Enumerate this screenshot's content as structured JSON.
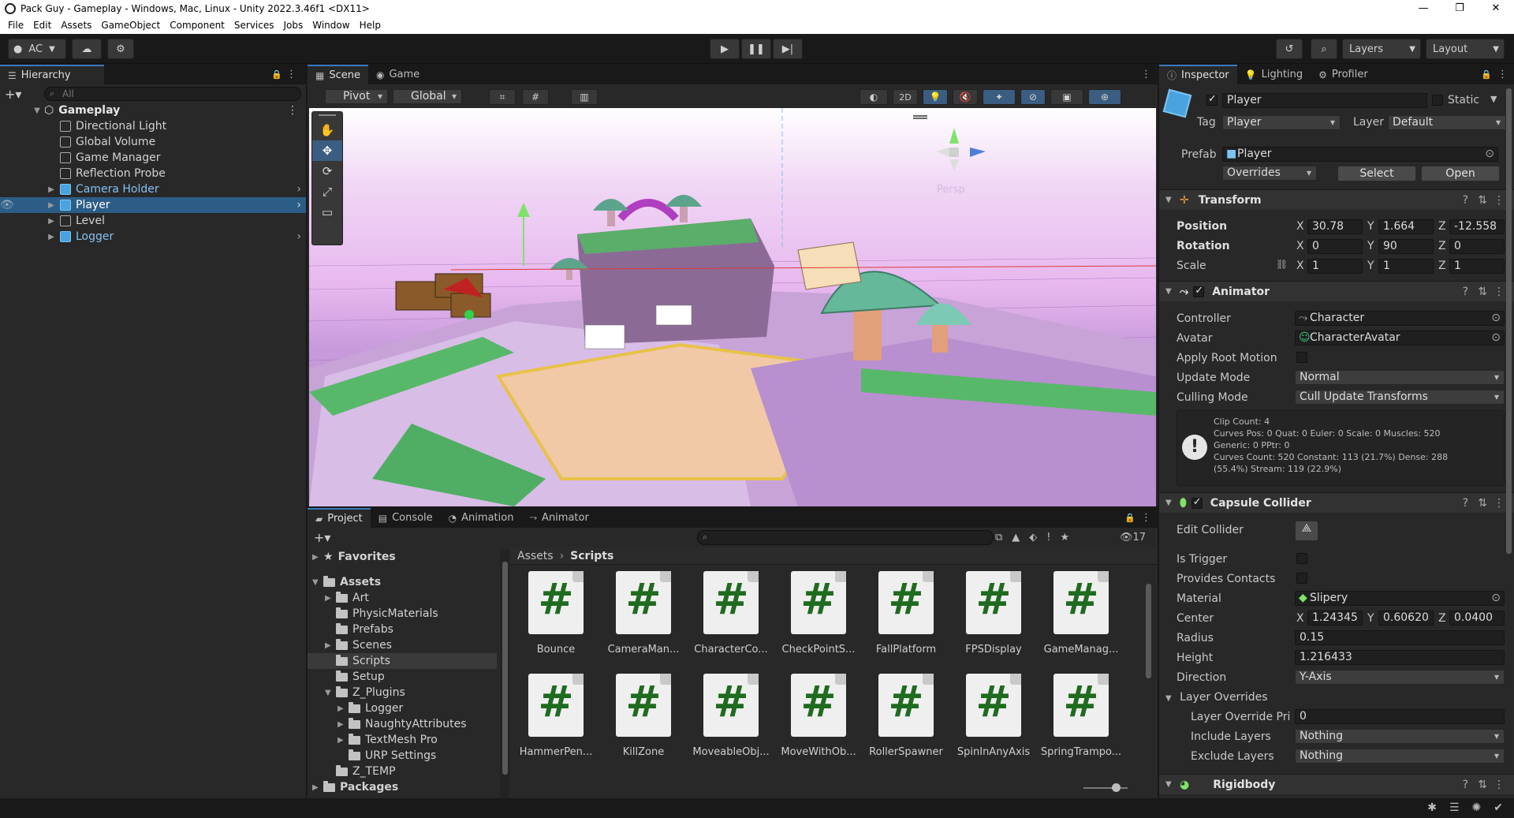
{
  "window": {
    "title": "Pack Guy - Gameplay - Windows, Mac, Linux - Unity 2022.3.46f1 <DX11>",
    "controls": [
      "—",
      "❐",
      "✕"
    ]
  },
  "menu": [
    "File",
    "Edit",
    "Assets",
    "GameObject",
    "Component",
    "Services",
    "Jobs",
    "Window",
    "Help"
  ],
  "toolbar": {
    "account": "AC",
    "layers": "Layers",
    "layout": "Layout"
  },
  "hierarchy": {
    "tab": "Hierarchy",
    "search_placeholder": "All",
    "scene": "Gameplay",
    "items": [
      {
        "label": "Directional Light",
        "prefab": false
      },
      {
        "label": "Global Volume",
        "prefab": false
      },
      {
        "label": "Game Manager",
        "prefab": false
      },
      {
        "label": "Reflection Probe",
        "prefab": false
      },
      {
        "label": "Camera Holder",
        "prefab": true
      },
      {
        "label": "Player",
        "prefab": true
      },
      {
        "label": "Level",
        "prefab": false
      },
      {
        "label": "Logger",
        "prefab": true
      }
    ]
  },
  "scene": {
    "tabs": [
      "Scene",
      "Game"
    ],
    "pivot": "Pivot",
    "global": "Global",
    "mode2d": "2D",
    "persp": "Persp"
  },
  "project": {
    "tabs": [
      "Project",
      "Console",
      "Animation",
      "Animator"
    ],
    "count": "17",
    "breadcrumb": [
      "Assets",
      "Scripts"
    ],
    "tree": [
      {
        "label": "Favorites",
        "depth": 0,
        "bold": true
      },
      {
        "label": "Assets",
        "depth": 0,
        "bold": true
      },
      {
        "label": "Art",
        "depth": 1
      },
      {
        "label": "PhysicMaterials",
        "depth": 1
      },
      {
        "label": "Prefabs",
        "depth": 1
      },
      {
        "label": "Scenes",
        "depth": 1
      },
      {
        "label": "Scripts",
        "depth": 1
      },
      {
        "label": "Setup",
        "depth": 1
      },
      {
        "label": "Z_Plugins",
        "depth": 1
      },
      {
        "label": "Logger",
        "depth": 2
      },
      {
        "label": "NaughtyAttributes",
        "depth": 2
      },
      {
        "label": "TextMesh Pro",
        "depth": 2
      },
      {
        "label": "URP Settings",
        "depth": 2
      },
      {
        "label": "Z_TEMP",
        "depth": 1
      },
      {
        "label": "Packages",
        "depth": 0,
        "bold": true
      }
    ],
    "assets": [
      "Bounce",
      "CameraMan...",
      "CharacterCo...",
      "CheckPointS...",
      "FallPlatform",
      "FPSDisplay",
      "GameManag...",
      "HammerPen...",
      "KillZone",
      "MoveableObj...",
      "MoveWithOb...",
      "RollerSpawner",
      "SpinInAnyAxis",
      "SpringTrampo..."
    ]
  },
  "inspector": {
    "tabs": [
      "Inspector",
      "Lighting",
      "Profiler"
    ],
    "name": "Player",
    "static": "Static",
    "tag_label": "Tag",
    "tag": "Player",
    "layer_label": "Layer",
    "layer": "Default",
    "prefab_label": "Prefab",
    "prefab": "Player",
    "overrides": "Overrides",
    "select": "Select",
    "open": "Open",
    "transform": {
      "title": "Transform",
      "position": {
        "label": "Position",
        "x": "30.78",
        "y": "1.664",
        "z": "-12.558"
      },
      "rotation": {
        "label": "Rotation",
        "x": "0",
        "y": "90",
        "z": "0"
      },
      "scale": {
        "label": "Scale",
        "x": "1",
        "y": "1",
        "z": "1"
      }
    },
    "animator": {
      "title": "Animator",
      "controller_label": "Controller",
      "controller": "Character",
      "avatar_label": "Avatar",
      "avatar": "CharacterAvatar",
      "root_motion_label": "Apply Root Motion",
      "update_mode_label": "Update Mode",
      "update_mode": "Normal",
      "culling_mode_label": "Culling Mode",
      "culling_mode": "Cull Update Transforms",
      "info": [
        "Clip Count: 4",
        "Curves Pos: 0 Quat: 0 Euler: 0 Scale: 0 Muscles: 520",
        "Generic: 0 PPtr: 0",
        "Curves Count: 520 Constant: 113 (21.7%) Dense: 288",
        "(55.4%) Stream: 119 (22.9%)"
      ]
    },
    "capsule": {
      "title": "Capsule Collider",
      "edit_label": "Edit Collider",
      "trigger_label": "Is Trigger",
      "contacts_label": "Provides Contacts",
      "material_label": "Material",
      "material": "Slipery",
      "center_label": "Center",
      "cx": "1.24345",
      "cy": "0.60620",
      "cz": "0.0400",
      "radius_label": "Radius",
      "radius": "0.15",
      "height_label": "Height",
      "height": "1.216433",
      "direction_label": "Direction",
      "direction": "Y-Axis",
      "layer_overrides": "Layer Overrides",
      "override_priority_label": "Layer Override Pri",
      "override_priority": "0",
      "include_label": "Include Layers",
      "include": "Nothing",
      "exclude_label": "Exclude Layers",
      "exclude": "Nothing"
    },
    "rigidbody": {
      "title": "Rigidbody"
    }
  }
}
